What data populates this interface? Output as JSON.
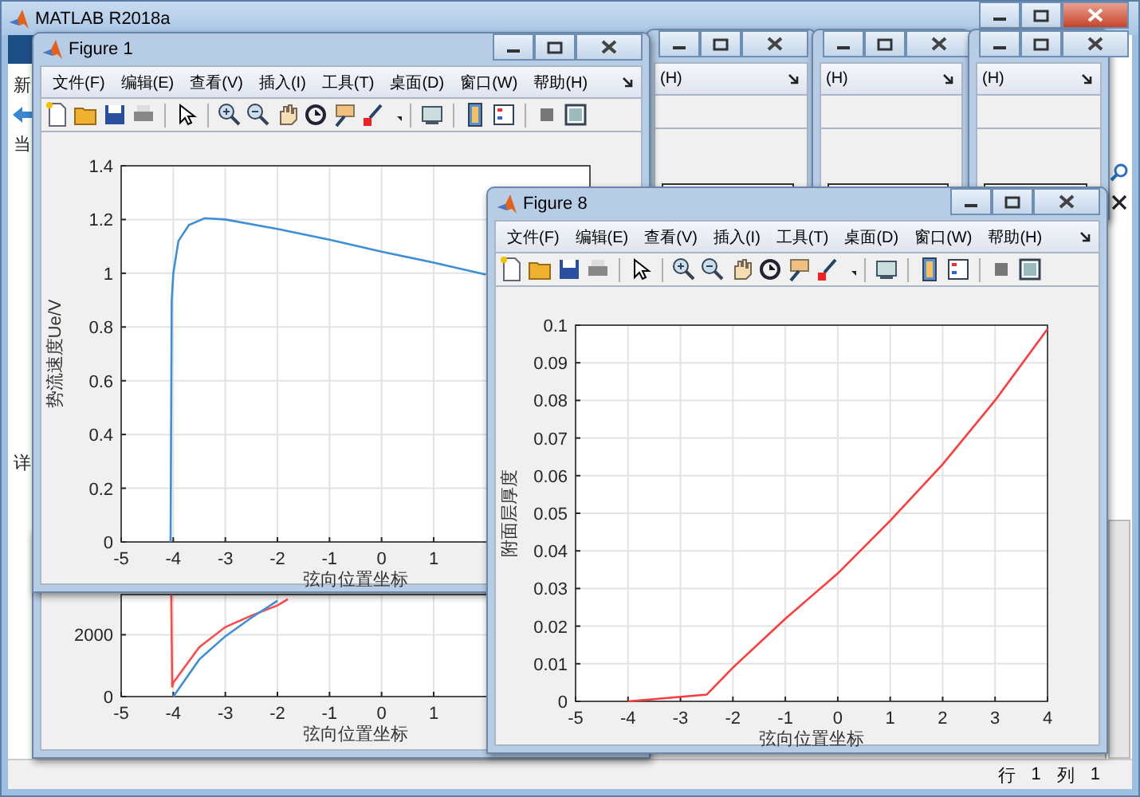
{
  "window": {
    "title": "MATLAB R2018a"
  },
  "side_panel": {
    "labels": [
      "新",
      "当",
      "详"
    ]
  },
  "background_figures": [
    {
      "menu_fragment": "(H)"
    },
    {
      "menu_fragment": "(H)"
    },
    {
      "menu_fragment": "(H)"
    }
  ],
  "figures": [
    {
      "title": "Figure 1",
      "menu": [
        "文件(F)",
        "编辑(E)",
        "查看(V)",
        "插入(I)",
        "工具(T)",
        "桌面(D)",
        "窗口(W)",
        "帮助(H)"
      ],
      "chart_data": {
        "type": "line",
        "grid": true,
        "xlabel": "弦向位置坐标",
        "ylabel": "势流速度Ue/V",
        "xlim": [
          -5,
          4
        ],
        "ylim": [
          0,
          1.4
        ],
        "xticks": [
          -5,
          -4,
          -3,
          -2,
          -1,
          0,
          1
        ],
        "yticks": [
          0,
          0.2,
          0.4,
          0.6,
          0.8,
          1,
          1.2,
          1.4
        ],
        "x": [
          -4.05,
          -4.03,
          -4,
          -3.9,
          -3.7,
          -3.4,
          -3,
          -2,
          -1,
          0,
          1,
          2
        ],
        "series": [
          {
            "color": "#3d8fd8",
            "values": [
              0,
              0.9,
              1.0,
              1.12,
              1.18,
              1.205,
              1.2,
              1.165,
              1.125,
              1.08,
              1.04,
              0.995
            ]
          }
        ]
      }
    },
    {
      "title": "Figure 8",
      "menu": [
        "文件(F)",
        "编辑(E)",
        "查看(V)",
        "插入(I)",
        "工具(T)",
        "桌面(D)",
        "窗口(W)",
        "帮助(H)"
      ],
      "chart_data": {
        "type": "line",
        "grid": true,
        "xlabel": "弦向位置坐标",
        "ylabel": "附面层厚度",
        "xlim": [
          -5,
          4
        ],
        "ylim": [
          0,
          0.1
        ],
        "xticks": [
          -5,
          -4,
          -3,
          -2,
          -1,
          0,
          1,
          2,
          3,
          4
        ],
        "yticks": [
          0,
          0.01,
          0.02,
          0.03,
          0.04,
          0.05,
          0.06,
          0.07,
          0.08,
          0.09,
          0.1
        ],
        "x": [
          -4,
          -2.5,
          -2,
          -1,
          0,
          1,
          2,
          3,
          4
        ],
        "series": [
          {
            "color": "#ff3b3b",
            "values": [
              0,
              0.0018,
              0.009,
              0.022,
              0.034,
              0.048,
              0.063,
              0.08,
              0.099
            ]
          }
        ]
      }
    }
  ],
  "lower_figure": {
    "chart_data": {
      "type": "line",
      "grid": true,
      "xlabel": "弦向位置坐标",
      "xlim": [
        -5,
        4
      ],
      "ylim": [
        0,
        3300
      ],
      "xticks": [
        -5,
        -4,
        -3,
        -2,
        -1,
        0,
        1
      ],
      "yticks": [
        0,
        2000
      ],
      "x": [
        -4.04,
        -4.02,
        -4,
        -3.5,
        -3,
        -2.5,
        -2,
        -1.8
      ],
      "series": [
        {
          "color": "#ff4a4a",
          "values": [
            3300,
            300,
            450,
            1600,
            2250,
            2620,
            2950,
            3150
          ]
        },
        {
          "color": "#3d8fd8",
          "values": [
            null,
            null,
            0,
            1200,
            1950,
            2550,
            3100,
            null
          ]
        }
      ]
    }
  },
  "status_bar": {
    "row_label": "行",
    "row": "1",
    "col_label": "列",
    "col": "1"
  }
}
